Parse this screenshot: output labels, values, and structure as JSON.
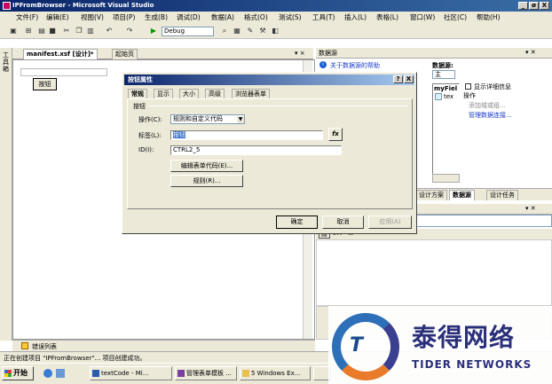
{
  "window": {
    "title": "IPFromBrowser - Microsoft Visual Studio",
    "minimize": "_",
    "restore": "ø",
    "close": "X"
  },
  "menu": [
    "文件(F)",
    "编辑(E)",
    "视图(V)",
    "项目(P)",
    "生成(B)",
    "调试(D)",
    "数据(A)",
    "格式(O)",
    "测试(S)",
    "工具(T)",
    "插入(L)",
    "表格(L)",
    "窗口(W)",
    "社区(C)",
    "帮助(H)"
  ],
  "toolbar": {
    "config": "Debug"
  },
  "doc_tabs": [
    "manifest.xsf [设计]*",
    "起始页"
  ],
  "doc_close": "▾ ×",
  "toolbox_label": "工具箱",
  "designer": {
    "button_label": "按钮"
  },
  "dialog": {
    "title": "按钮属性",
    "help_btn": "?",
    "close_btn": "X",
    "tabs": [
      "常规",
      "显示",
      "大小",
      "高级",
      "浏览器表单"
    ],
    "group_label": "按钮",
    "action_label": "操作(C):",
    "action_value": "规则和自定义代码",
    "caption_label": "标签(L):",
    "caption_value": "按钮",
    "fx": "fx",
    "id_label": "ID(I):",
    "id_value": "CTRL2_5",
    "edit_code_btn": "编辑表单代码(E)...",
    "rules_btn": "规则(R)...",
    "ok": "确定",
    "cancel": "取消",
    "apply": "应用(A)"
  },
  "datasource": {
    "title": "数据源",
    "pin": "▾ ✕",
    "help_link": "关于数据源的帮助",
    "ds_label": "数据源:",
    "ds_value": "主",
    "tree_item1": "myFiel",
    "tree_item2": "tex",
    "show_details": "显示详细信息",
    "ops_label": "操作",
    "add_group": "添加域或组...",
    "manage_conn": "管理数据连接..."
  },
  "task_tabs": [
    "设计方案",
    "数据源",
    "设计任务"
  ],
  "props_pin": "▾ ✕",
  "error_list": "错误列表",
  "status_text": "正在创建项目 \"IPFromBrowser\"... 项目创建成功。",
  "taskbar": {
    "start": "开始",
    "tasks": [
      "textCode - Mi...",
      "管理表单模板 ...",
      "5 Windows Ex...",
      ""
    ]
  },
  "watermark": {
    "cn": "泰得网络",
    "en": "TIDER NETWORKS"
  }
}
